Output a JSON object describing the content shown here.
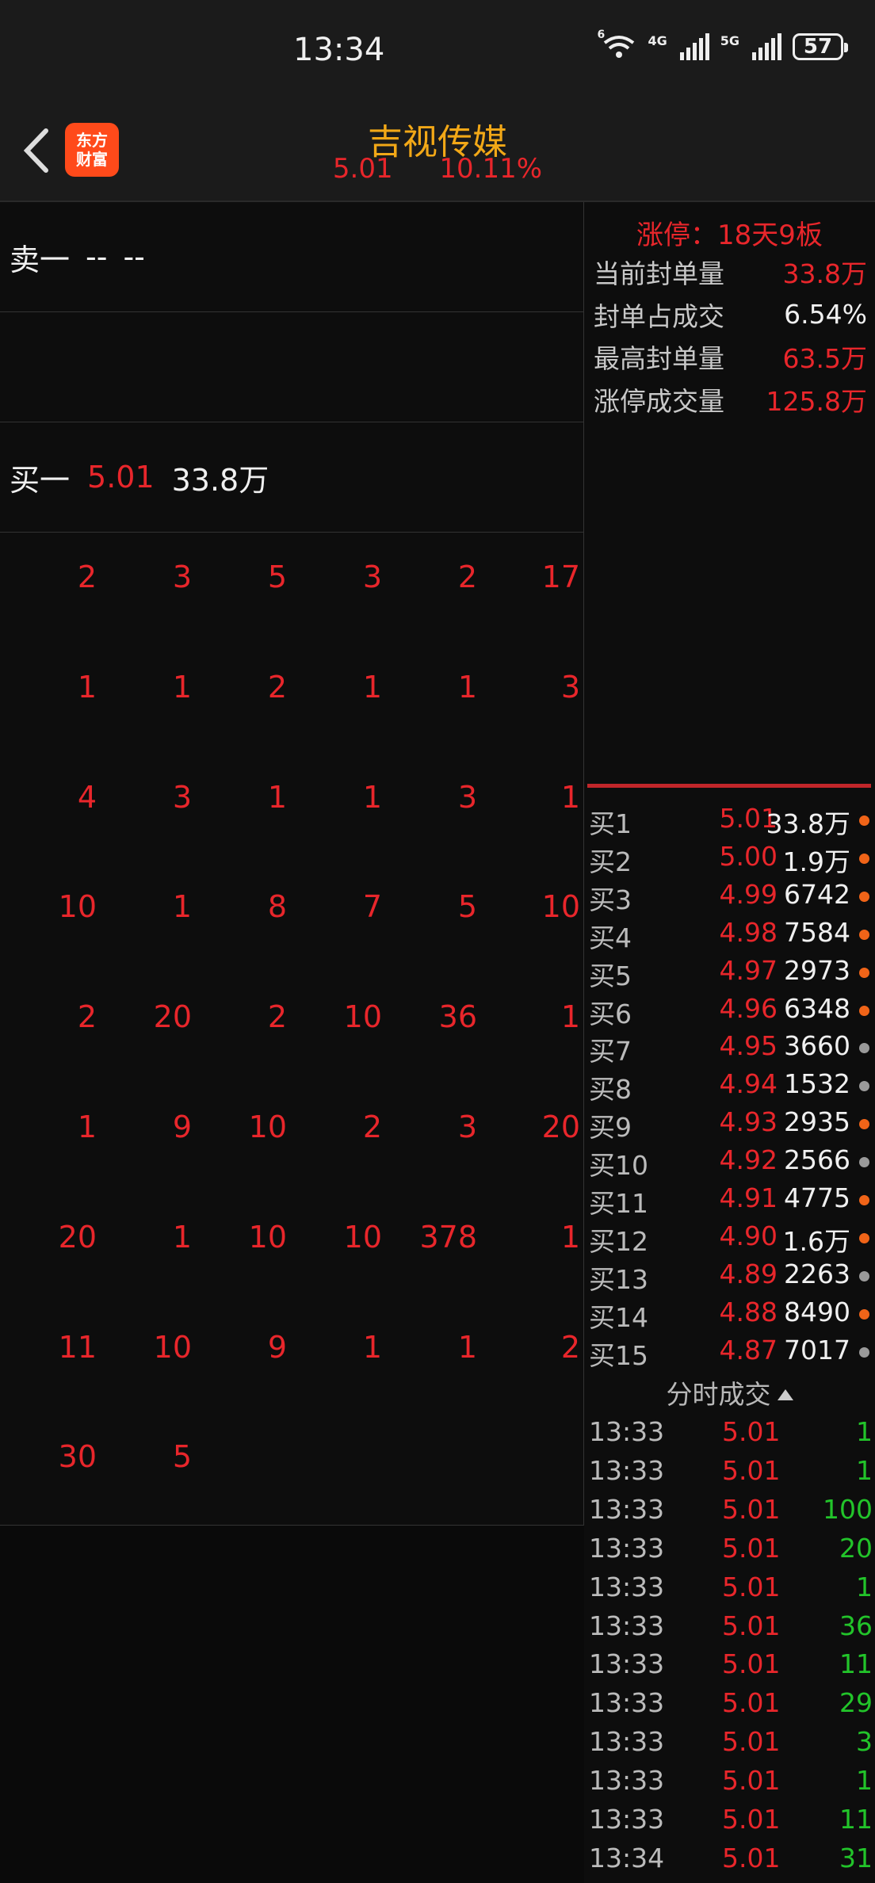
{
  "status_bar": {
    "time": "13:34",
    "wifi_badge": "6",
    "net1": "4G",
    "net2": "5G",
    "battery": "57"
  },
  "header": {
    "title": "吉视传媒",
    "price": "5.01",
    "change_pct": "10.11%",
    "logo_line1": "东方",
    "logo_line2": "财富"
  },
  "sell_one": {
    "label": "卖一",
    "price": "--",
    "volume": "--"
  },
  "buy_one": {
    "label": "买一",
    "price": "5.01",
    "volume": "33.8万"
  },
  "queue_rows": [
    [
      "2",
      "3",
      "5",
      "3",
      "2",
      "17"
    ],
    [
      "1",
      "1",
      "2",
      "1",
      "1",
      "3"
    ],
    [
      "4",
      "3",
      "1",
      "1",
      "3",
      "1"
    ],
    [
      "10",
      "1",
      "8",
      "7",
      "5",
      "10"
    ],
    [
      "2",
      "20",
      "2",
      "10",
      "36",
      "1"
    ],
    [
      "1",
      "9",
      "10",
      "2",
      "3",
      "20"
    ],
    [
      "20",
      "1",
      "10",
      "10",
      "378",
      "1"
    ],
    [
      "11",
      "10",
      "9",
      "1",
      "1",
      "2"
    ],
    [
      "30",
      "5"
    ]
  ],
  "limit_up": {
    "title": "涨停：18天9板",
    "stats": [
      {
        "key": "当前封单量",
        "value": "33.8万",
        "color": "red"
      },
      {
        "key": "封单占成交",
        "value": "6.54%",
        "color": "white"
      },
      {
        "key": "最高封单量",
        "value": "63.5万",
        "color": "red"
      },
      {
        "key": "涨停成交量",
        "value": "125.8万",
        "color": "red"
      }
    ]
  },
  "order_book": [
    {
      "label": "买1",
      "price": "5.01",
      "volume": "33.8万",
      "dot": "#f06418"
    },
    {
      "label": "买2",
      "price": "5.00",
      "volume": "1.9万",
      "dot": "#f06418"
    },
    {
      "label": "买3",
      "price": "4.99",
      "volume": "6742",
      "dot": "#f06418"
    },
    {
      "label": "买4",
      "price": "4.98",
      "volume": "7584",
      "dot": "#f06418"
    },
    {
      "label": "买5",
      "price": "4.97",
      "volume": "2973",
      "dot": "#f06418"
    },
    {
      "label": "买6",
      "price": "4.96",
      "volume": "6348",
      "dot": "#f06418"
    },
    {
      "label": "买7",
      "price": "4.95",
      "volume": "3660",
      "dot": "#9a9a9a"
    },
    {
      "label": "买8",
      "price": "4.94",
      "volume": "1532",
      "dot": "#9a9a9a"
    },
    {
      "label": "买9",
      "price": "4.93",
      "volume": "2935",
      "dot": "#f06418"
    },
    {
      "label": "买10",
      "price": "4.92",
      "volume": "2566",
      "dot": "#9a9a9a"
    },
    {
      "label": "买11",
      "price": "4.91",
      "volume": "4775",
      "dot": "#f06418"
    },
    {
      "label": "买12",
      "price": "4.90",
      "volume": "1.6万",
      "dot": "#f06418"
    },
    {
      "label": "买13",
      "price": "4.89",
      "volume": "2263",
      "dot": "#9a9a9a"
    },
    {
      "label": "买14",
      "price": "4.88",
      "volume": "8490",
      "dot": "#f06418"
    },
    {
      "label": "买15",
      "price": "4.87",
      "volume": "7017",
      "dot": "#9a9a9a"
    }
  ],
  "ticks_title": "分时成交",
  "ticks": [
    {
      "time": "13:33",
      "price": "5.01",
      "volume": "1"
    },
    {
      "time": "13:33",
      "price": "5.01",
      "volume": "1"
    },
    {
      "time": "13:33",
      "price": "5.01",
      "volume": "100"
    },
    {
      "time": "13:33",
      "price": "5.01",
      "volume": "20"
    },
    {
      "time": "13:33",
      "price": "5.01",
      "volume": "1"
    },
    {
      "time": "13:33",
      "price": "5.01",
      "volume": "36"
    },
    {
      "time": "13:33",
      "price": "5.01",
      "volume": "11"
    },
    {
      "time": "13:33",
      "price": "5.01",
      "volume": "29"
    },
    {
      "time": "13:33",
      "price": "5.01",
      "volume": "3"
    },
    {
      "time": "13:33",
      "price": "5.01",
      "volume": "1"
    },
    {
      "time": "13:33",
      "price": "5.01",
      "volume": "11"
    },
    {
      "time": "13:34",
      "price": "5.01",
      "volume": "31"
    }
  ]
}
